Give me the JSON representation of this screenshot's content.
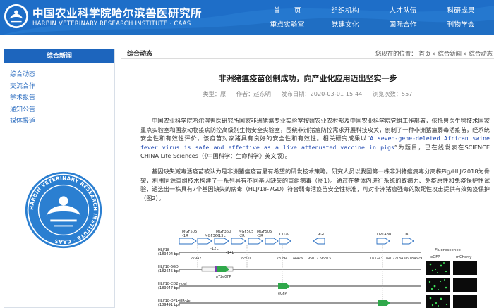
{
  "header": {
    "institute_cn": "中国农业科学院哈尔滨兽医研究所",
    "institute_en": "HARBIN VETERINARY RESEARCH INSTITUTE · CAAS",
    "nav": [
      {
        "label": "首　　页"
      },
      {
        "label": "组织机构"
      },
      {
        "label": "人才队伍"
      },
      {
        "label": "科研成果"
      },
      {
        "label": "重点实验室"
      },
      {
        "label": "党建文化"
      },
      {
        "label": "国际合作"
      },
      {
        "label": "刊物学会"
      }
    ]
  },
  "sidebar": {
    "title": "综合新闻",
    "items": [
      {
        "label": "综合动态"
      },
      {
        "label": "交流合作"
      },
      {
        "label": "学术报告"
      },
      {
        "label": "通知公告"
      },
      {
        "label": "媒体报道"
      }
    ],
    "emblem_text": "HARBIN VETERINARY RESEARCH INSTITUTE · CAAS"
  },
  "main": {
    "section_name": "综合动态",
    "breadcrumb": {
      "prefix": "您现在的位置：",
      "items": [
        "首页",
        "综合新闻",
        "综合动态"
      ],
      "separator": "»"
    },
    "article": {
      "title": "非洲猪瘟疫苗创制成功，向产业化应用迈出坚实一步",
      "meta": {
        "category": "类型：原",
        "author": "作者：赵东明",
        "published": "发布日期：2020-03-01 15:44",
        "views": "浏览次数：557"
      },
      "paragraph1_before": "中国农业科学院哈尔滨兽医研究所国家非洲猪瘟专业实验室按照农业农村部及中国农业科学院党组工作部署，依托兽医生物技术国家重点实验室和国家动物疫病防控高级别生物安全实验室，围绕非洲猪瘟防控需求开展科技攻关，创制了一种非洲猪瘟弱毒活疫苗，经系统安全性和有效性评价，该疫苗对家猪具有良好的安全性和有效性。相关研究成果以“",
      "paragraph1_highlight": "A seven-gene-deleted African swine fever virus is safe and effective as a live attenuated vaccine in pigs",
      "paragraph1_after": "”为题目，已在线发表在SCIENCE CHINA Life Sciences（《中国科学：生命科学》英文版）。",
      "paragraph2": "基因缺失减毒活疫苗被认为是非洲猪瘟疫苗最有希望的研发技术策略。研究人员以我国第一株非洲猪瘟病毒分离株Pig/HLJ/2018为骨架，利用同源重组技术构建了一系列具有不同基因缺失的重组病毒（图1）。通过在猪体内进行系统的致病力、免疫原性和免疫保护性试验，遴选出一株具有7个基因缺失的病毒（HLJ/18-7GD）符合弱毒活疫苗安全性标准，可对非洲猪瘟强毒的致死性攻击提供有效免疫保护（图2）。"
    },
    "figure": {
      "gene_labels_top": [
        "MGF505",
        "MGF360",
        "MGF505",
        "MGF505",
        "CD2v",
        "9GL",
        "DP148R",
        "UK"
      ],
      "gene_labels_top2": [
        "-1R",
        "-12L",
        "-13L",
        "-14L",
        "-2R",
        "-3R"
      ],
      "coords": [
        "27942",
        "35500",
        "73394",
        "74476",
        "95017",
        "95315",
        "183243",
        "184077",
        "184389",
        "184679"
      ],
      "strains": [
        {
          "name": "HLJ/18",
          "size": "(189404 bp)"
        },
        {
          "name": "HLJ/18-6GD",
          "size": "(182645 bp)"
        },
        {
          "name": "HLJ/18-CD2v-del",
          "size": "(189047 bp)"
        },
        {
          "name": "HLJ/18-DP148R-del",
          "size": "(189491 bp)"
        }
      ],
      "markers": [
        "p72eGFP",
        "eGFP",
        "eGFP"
      ],
      "fluorescence_title": "Fluorescence",
      "fluorescence_cols": [
        "eGFP",
        "mCherry"
      ]
    }
  }
}
